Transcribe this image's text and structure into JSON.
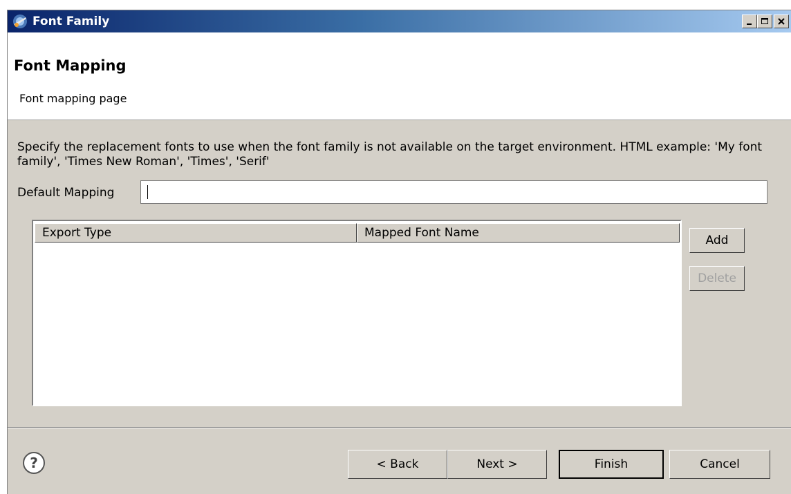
{
  "window": {
    "title": "Font Family",
    "icon": "eclipse-app-icon"
  },
  "titlebar_buttons": {
    "minimize_icon": "minimize-icon",
    "maximize_icon": "maximize-icon",
    "close_icon": "close-icon"
  },
  "header": {
    "title": "Font Mapping",
    "subtitle": "Font mapping page"
  },
  "description": "Specify the replacement fonts to use when the font family is not available on the target environment. HTML example: 'My font family', 'Times New Roman', 'Times', 'Serif'",
  "default_mapping": {
    "label": "Default Mapping",
    "value": ""
  },
  "table": {
    "columns": [
      "Export Type",
      "Mapped Font Name"
    ],
    "rows": []
  },
  "side_buttons": {
    "add": "Add",
    "delete": "Delete"
  },
  "footer": {
    "help_icon": "help-icon",
    "back": "< Back",
    "next": "Next >",
    "finish": "Finish",
    "cancel": "Cancel"
  }
}
